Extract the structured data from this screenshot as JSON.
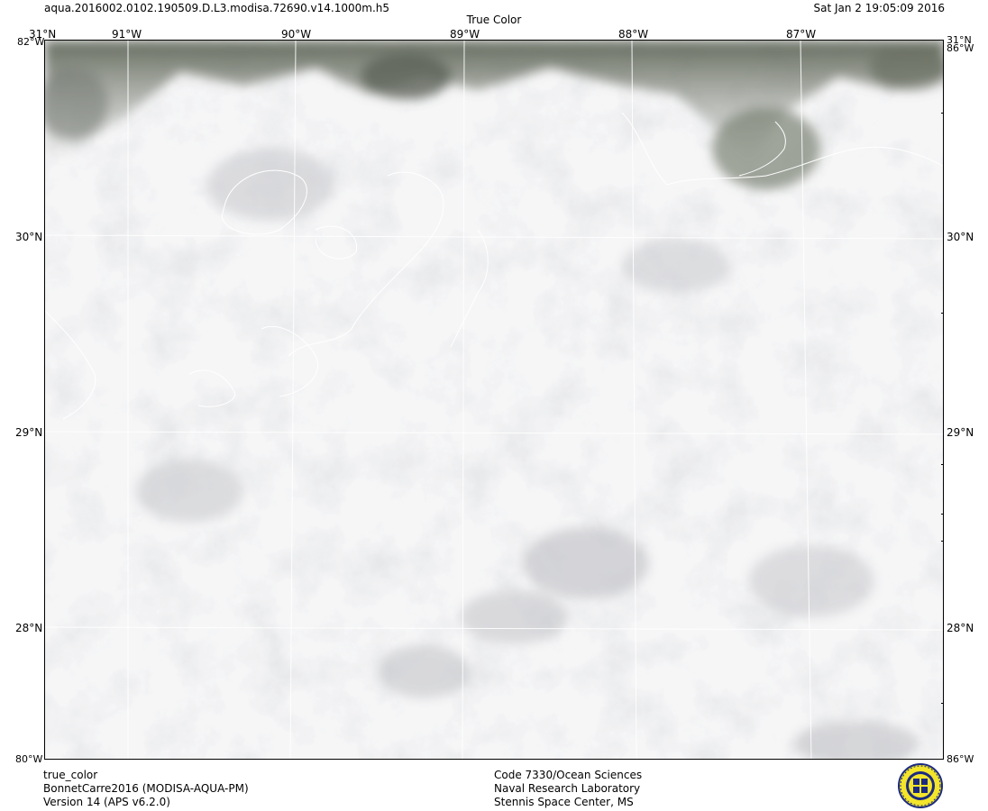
{
  "header": {
    "filename": "aqua.2016002.0102.190509.D.L3.modisa.72690.v14.1000m.h5",
    "product_title": "True Color",
    "datetime": "Sat Jan  2 19:05:09 2016"
  },
  "map": {
    "lon_labels_top": [
      "91°W",
      "90°W",
      "89°W",
      "88°W",
      "87°W"
    ],
    "lat_labels_left": [
      "31°N",
      "30°N",
      "29°N",
      "28°N"
    ],
    "lat_labels_right": [
      "31°N",
      "30°N",
      "29°N",
      "28°N"
    ],
    "corner_labels": {
      "top_left": "31°N",
      "top_left_overlap": "82°W",
      "top_right_overlap": "31°N 86°W",
      "bottom_left": "80°W",
      "bottom_right": "86°W"
    },
    "imagery": "cloud-covered true color satellite image, mostly white and light gray, dark vegetated land along top edge",
    "colors": {
      "cloud": "#f4f4f5",
      "cloud_shadow": "#c9cacd",
      "land": "#6e7466",
      "coastline": "#ffffff",
      "gridline": "#ffffff",
      "frame": "#000000"
    }
  },
  "footer": {
    "left": [
      "true_color",
      "BonnetCarre2016 (MODISA-AQUA-PM)",
      "Version 14 (APS v6.2.0)"
    ],
    "center": [
      "Code 7330/Ocean Sciences",
      "Naval Research Laboratory",
      "Stennis Space Center, MS"
    ],
    "seal_icon": "nrl-seal-icon"
  }
}
